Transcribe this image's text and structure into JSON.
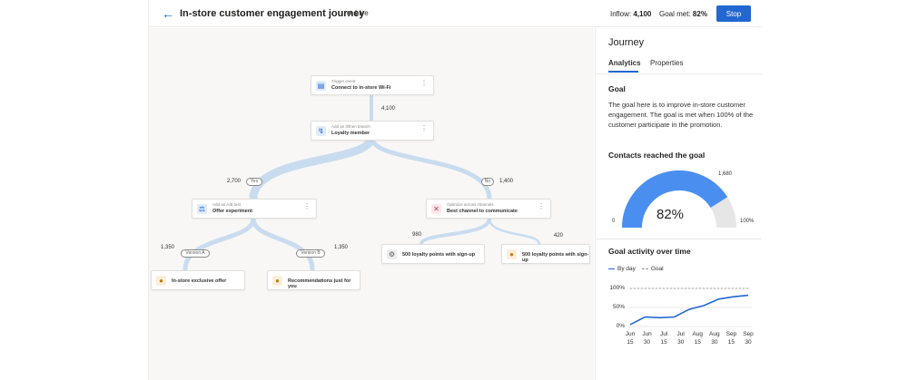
{
  "header": {
    "back_icon": "arrow-left-icon",
    "title": "In-store customer engagement journey",
    "status": "Live",
    "inflow_label": "Inflow:",
    "inflow_value": "4,100",
    "goal_met_label": "Goal met:",
    "goal_met_value": "82%",
    "stop_label": "Stop"
  },
  "flow": {
    "trigger": {
      "sub": "Trigger event",
      "label": "Connect to in-store Wi-Fi",
      "icon": "wifi-event-icon"
    },
    "branch": {
      "sub": "Add an if/then branch",
      "label": "Loyalty member",
      "icon": "lightning-icon"
    },
    "ab_test": {
      "sub": "Add an A/B test",
      "label": "Offer experiment",
      "icon": "flask-icon"
    },
    "optimize": {
      "sub": "Optimize across channels",
      "label": "Best channel to communicate",
      "icon": "channel-optimize-icon"
    },
    "leaf_a": {
      "label": "In-store exclusive offer",
      "icon": "offer-icon"
    },
    "leaf_b": {
      "label": "Recommendations just for you",
      "icon": "offer-icon"
    },
    "leaf_c": {
      "label": "500 loyalty points with sign-up",
      "icon": "gear-icon"
    },
    "leaf_d": {
      "label": "500 loyalty points with sign-up",
      "icon": "offer-icon"
    },
    "counts": {
      "trigger_out": "4,100",
      "yes": "2,700",
      "no": "1,400",
      "version_a": "1,350",
      "version_b": "1,350",
      "opt_left": "980",
      "opt_right": "420"
    },
    "pills": {
      "yes": "Yes",
      "no": "No",
      "version_a": "Version A",
      "version_b": "Version B"
    },
    "more_icon": "more-vertical-icon"
  },
  "panel": {
    "title": "Journey",
    "tabs": [
      {
        "label": "Analytics",
        "active": true
      },
      {
        "label": "Properties",
        "active": false
      }
    ],
    "goal_heading": "Goal",
    "goal_text": "The goal here is to improve in-store customer engagement. The goal is met when 100% of the customer participate in the promotion.",
    "contacts_heading": "Contacts reached the goal",
    "gauge": {
      "value_label": "82%",
      "fraction": 0.82,
      "min_label": "0",
      "max_label": "100%",
      "target_label": "1,680",
      "color": "#4a8ff0",
      "track_color": "#e6e6e6"
    },
    "activity_heading": "Goal activity over time",
    "legend": {
      "by_day": "By day",
      "goal": "Goal"
    }
  },
  "chart_data": {
    "type": "line",
    "title": "Goal activity over time",
    "x": [
      "Jun 15",
      "Jun 30",
      "Jul 15",
      "Jul 30",
      "Aug 15",
      "Aug 30",
      "Sep 15",
      "Sep 30"
    ],
    "series": [
      {
        "name": "By day",
        "values": [
          5,
          25,
          23,
          25,
          45,
          55,
          72,
          78,
          82
        ]
      },
      {
        "name": "Goal",
        "values": [
          100,
          100,
          100,
          100,
          100,
          100,
          100,
          100,
          100
        ]
      }
    ],
    "y_ticks": [
      "100%",
      "50%",
      "0%"
    ],
    "ylim": [
      0,
      100
    ],
    "colors": {
      "by_day": "#2266d2",
      "goal": "#8a8886"
    }
  }
}
